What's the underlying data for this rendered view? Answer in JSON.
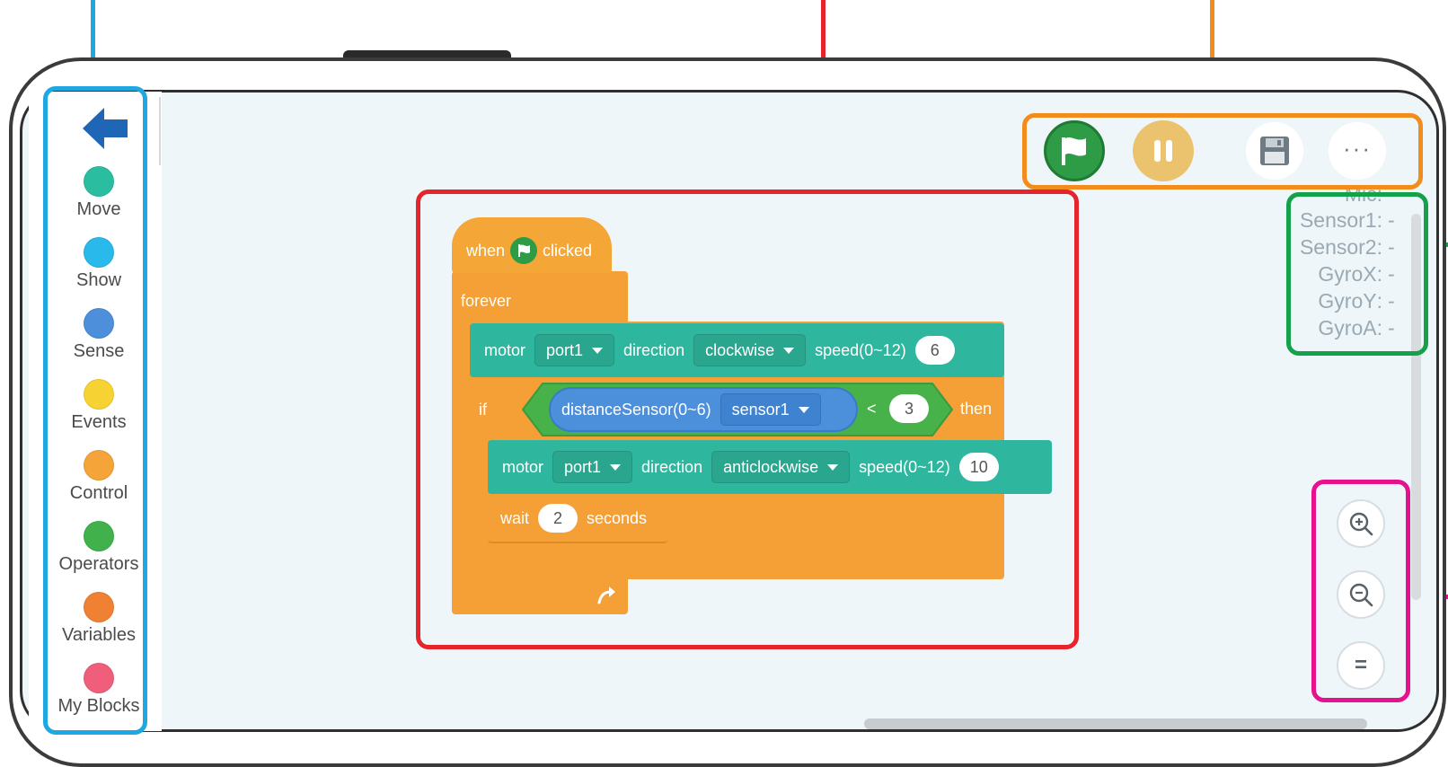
{
  "colors": {
    "sidebar_annotation": "#1ea7e1",
    "script_annotation": "#e5242b",
    "toolbar_annotation": "#f28c1c",
    "readouts_annotation": "#13a14a",
    "zoom_annotation": "#e5118f",
    "control_block": "#f4a036",
    "motion_block": "#2eb79e",
    "sense_block": "#4c8fdb",
    "operator_block": "#47b24a"
  },
  "sidebar": {
    "back_icon": "back-arrow-icon",
    "categories": [
      {
        "label": "Move",
        "color": "#2bbd9f"
      },
      {
        "label": "Show",
        "color": "#29b9ea"
      },
      {
        "label": "Sense",
        "color": "#4d8fdb"
      },
      {
        "label": "Events",
        "color": "#f6d233"
      },
      {
        "label": "Control",
        "color": "#f5a43a"
      },
      {
        "label": "Operators",
        "color": "#41b24b"
      },
      {
        "label": "Variables",
        "color": "#f08032"
      },
      {
        "label": "My Blocks",
        "color": "#ef5f7c"
      }
    ]
  },
  "toolbar": {
    "run_icon": "green-flag-icon",
    "pause_icon": "pause-icon",
    "save_icon": "floppy-disk-icon",
    "more_label": "···"
  },
  "readouts": [
    {
      "name": "Mic",
      "value": "-"
    },
    {
      "name": "Sensor1",
      "value": "-"
    },
    {
      "name": "Sensor2",
      "value": "-"
    },
    {
      "name": "GyroX",
      "value": "-"
    },
    {
      "name": "GyroY",
      "value": "-"
    },
    {
      "name": "GyroA",
      "value": "-"
    }
  ],
  "script": {
    "hat": {
      "when": "when",
      "clicked": "clicked"
    },
    "forever": "forever",
    "motor1": {
      "motor": "motor",
      "port": "port1",
      "direction": "direction",
      "dir_value": "clockwise",
      "speed": "speed(0~12)",
      "speed_value": "6"
    },
    "if_block": {
      "if": "if",
      "sensor_block": "distanceSensor(0~6)",
      "sensor_value": "sensor1",
      "op": "<",
      "compare_value": "3",
      "then": "then"
    },
    "motor2": {
      "motor": "motor",
      "port": "port1",
      "direction": "direction",
      "dir_value": "anticlockwise",
      "speed": "speed(0~12)",
      "speed_value": "10"
    },
    "wait": {
      "wait": "wait",
      "value": "2",
      "seconds": "seconds"
    }
  },
  "zoom": {
    "zoom_in_icon": "zoom-in-icon",
    "zoom_out_icon": "zoom-out-icon",
    "reset_label": "="
  }
}
